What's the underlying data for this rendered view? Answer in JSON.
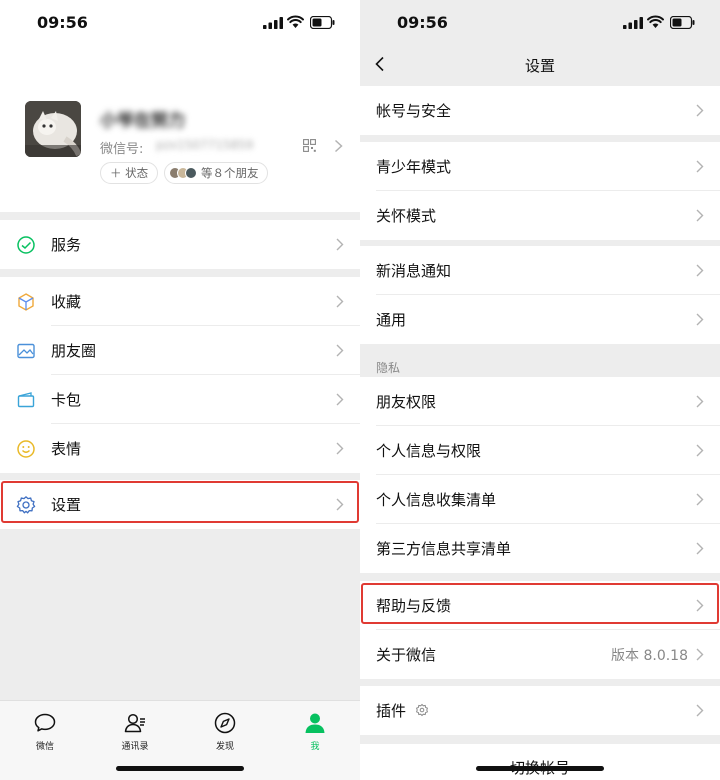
{
  "left": {
    "status_bar": {
      "time": "09:56"
    },
    "profile": {
      "nickname": "小爷在努力",
      "wechat_id_label": "微信号:",
      "wechat_id_value": "pzx1507715859",
      "status_button": "＋ 状态",
      "friends_text": "等８个朋友"
    },
    "menu": [
      {
        "label": "服务",
        "icon": "service-icon"
      },
      {
        "label": "收藏",
        "icon": "favorites-icon"
      },
      {
        "label": "朋友圈",
        "icon": "moments-icon"
      },
      {
        "label": "卡包",
        "icon": "card-wallet-icon"
      },
      {
        "label": "表情",
        "icon": "sticker-icon"
      },
      {
        "label": "设置",
        "icon": "settings-icon"
      }
    ],
    "tabbar": [
      {
        "label": "微信",
        "icon": "chat-icon"
      },
      {
        "label": "通讯录",
        "icon": "contacts-icon"
      },
      {
        "label": "发现",
        "icon": "discover-icon"
      },
      {
        "label": "我",
        "icon": "me-icon"
      }
    ],
    "accent_color": "#07c160",
    "highlight_color": "#e03a33"
  },
  "right": {
    "status_bar": {
      "time": "09:56"
    },
    "nav_title": "设置",
    "items": [
      {
        "label": "帐号与安全"
      },
      {
        "label": "青少年模式"
      },
      {
        "label": "关怀模式"
      },
      {
        "label": "新消息通知"
      },
      {
        "label": "通用"
      },
      {
        "label": "朋友权限"
      },
      {
        "label": "个人信息与权限"
      },
      {
        "label": "个人信息收集清单"
      },
      {
        "label": "第三方信息共享清单"
      },
      {
        "label": "帮助与反馈"
      },
      {
        "label": "关于微信",
        "value": "版本 8.0.18"
      },
      {
        "label": "插件"
      }
    ],
    "section_privacy": "隐私",
    "switch_account": "切换帐号"
  }
}
